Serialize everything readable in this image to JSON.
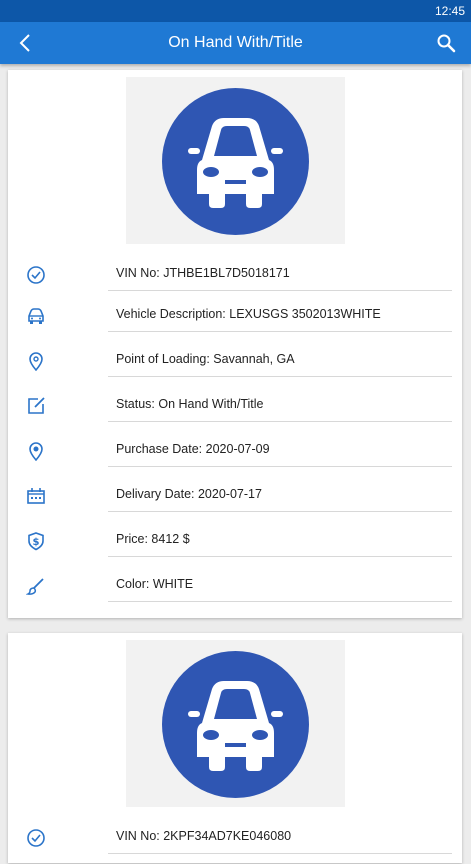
{
  "status_bar": {
    "time": "12:45"
  },
  "app_bar": {
    "title": "On Hand With/Title"
  },
  "vehicles": [
    {
      "image_icon": "car-icon",
      "fields": [
        {
          "icon": "check-circle-icon",
          "text": "VIN No: JTHBE1BL7D5018171"
        },
        {
          "icon": "car-outline-icon",
          "text": "Vehicle Description: LEXUSGS 3502013WHITE"
        },
        {
          "icon": "location-pin-icon",
          "text": "Point of Loading: Savannah, GA"
        },
        {
          "icon": "edit-square-icon",
          "text": "Status: On Hand With/Title"
        },
        {
          "icon": "location-pin-filled-icon",
          "text": "Purchase Date: 2020-07-09"
        },
        {
          "icon": "calendar-icon",
          "text": "Delivary Date: 2020-07-17"
        },
        {
          "icon": "dollar-shield-icon",
          "text": "Price: 8412 $"
        },
        {
          "icon": "paint-brush-icon",
          "text": "Color: WHITE"
        }
      ]
    },
    {
      "image_icon": "car-icon",
      "fields": [
        {
          "icon": "check-circle-icon",
          "text": "VIN No: 2KPF34AD7KE046080"
        }
      ]
    }
  ],
  "colors": {
    "status_bar": "#0d57a8",
    "app_bar": "#1f79d4",
    "icon_blue": "#2b74c9",
    "avatar_blue": "#2f56b3"
  }
}
